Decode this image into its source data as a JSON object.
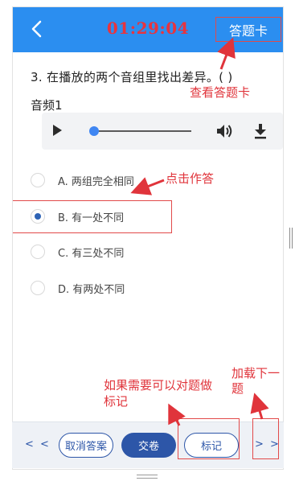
{
  "header": {
    "timer": "01:29:04",
    "answer_card": "答题卡",
    "back_icon": "chevron-left-icon"
  },
  "question": {
    "text": "3. 在播放的两个音组里找出差异。(   )",
    "audio_label": "音频1"
  },
  "player": {
    "play_icon": "play-icon",
    "volume_icon": "volume-icon",
    "download_icon": "download-icon",
    "progress": 0.0
  },
  "options": [
    {
      "label": "A. 两组完全相同",
      "selected": false
    },
    {
      "label": "B. 有一处不同",
      "selected": true
    },
    {
      "label": "C. 有三处不同",
      "selected": false
    },
    {
      "label": "D. 有两处不同",
      "selected": false
    }
  ],
  "footer": {
    "prev": "< <",
    "cancel": "取消答案",
    "submit": "交卷",
    "mark": "标记",
    "next": "> >"
  },
  "annotations": {
    "view_card": "查看答题卡",
    "click_answer": "点击作答",
    "mark_hint_line1": "如果需要可以对题做",
    "mark_hint_line2": "标记",
    "next_hint_line1": "加载下一",
    "next_hint_line2": "题"
  },
  "colors": {
    "header_blue": "#2b8ef0",
    "timer_red": "#e8343e",
    "primary_navy": "#2d56a8",
    "annotation_red": "#e0343b"
  }
}
